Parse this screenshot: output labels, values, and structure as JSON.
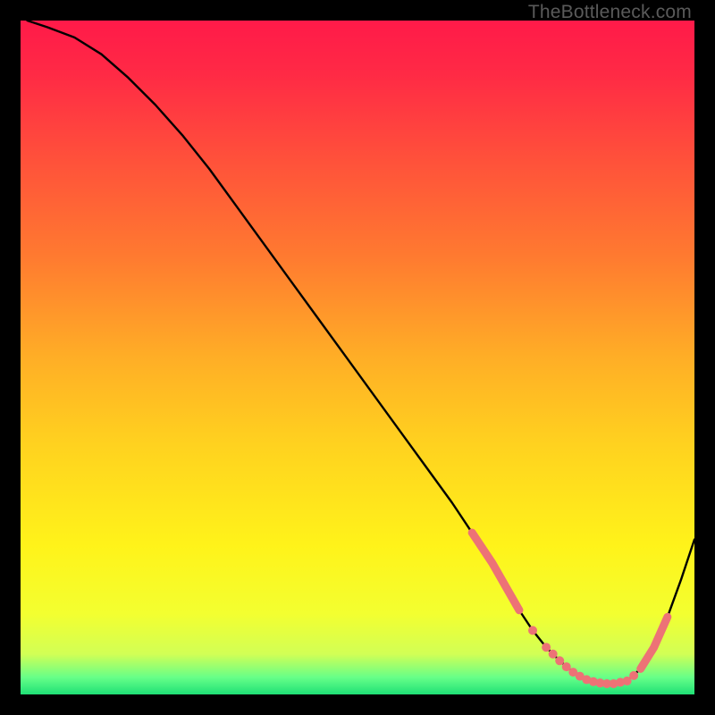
{
  "watermark": "TheBottleneck.com",
  "gradient_stops": [
    {
      "offset": 0.0,
      "color": "#ff1a49"
    },
    {
      "offset": 0.08,
      "color": "#ff2a45"
    },
    {
      "offset": 0.2,
      "color": "#ff4f3b"
    },
    {
      "offset": 0.35,
      "color": "#ff7a30"
    },
    {
      "offset": 0.5,
      "color": "#ffae26"
    },
    {
      "offset": 0.63,
      "color": "#ffd21f"
    },
    {
      "offset": 0.78,
      "color": "#fff31a"
    },
    {
      "offset": 0.88,
      "color": "#f3ff30"
    },
    {
      "offset": 0.94,
      "color": "#d2ff55"
    },
    {
      "offset": 0.975,
      "color": "#66ff88"
    },
    {
      "offset": 1.0,
      "color": "#1fe076"
    }
  ],
  "chart_data": {
    "type": "line",
    "title": "",
    "xlabel": "",
    "ylabel": "",
    "xlim": [
      0,
      100
    ],
    "ylim": [
      0,
      100
    ],
    "series": [
      {
        "name": "bottleneck-curve",
        "color": "#000000",
        "x": [
          1,
          4,
          8,
          12,
          16,
          20,
          24,
          28,
          32,
          36,
          40,
          44,
          48,
          52,
          56,
          60,
          64,
          67,
          70,
          72,
          74,
          76,
          78,
          80,
          82,
          84,
          86,
          88,
          90,
          92,
          94,
          96,
          98,
          100
        ],
        "y": [
          100,
          99,
          97.5,
          95,
          91.5,
          87.5,
          83,
          78,
          72.5,
          67,
          61.5,
          56,
          50.5,
          45,
          39.5,
          34,
          28.5,
          24,
          19.5,
          16,
          12.5,
          9.5,
          7,
          5,
          3.3,
          2.2,
          1.7,
          1.6,
          2.0,
          3.8,
          7.0,
          11.5,
          17,
          23
        ]
      }
    ],
    "highlight_segments": [
      {
        "name": "left-pink-segment",
        "color": "#ed7276",
        "stroke_width": 9,
        "x": [
          67,
          70,
          72,
          74
        ],
        "y": [
          24,
          19.5,
          16,
          12.5
        ]
      },
      {
        "name": "right-pink-segment",
        "color": "#ed7276",
        "stroke_width": 9,
        "x": [
          92,
          94,
          96
        ],
        "y": [
          3.8,
          7.0,
          11.5
        ]
      }
    ],
    "highlight_points": {
      "name": "trough-points",
      "color": "#ed7276",
      "radius": 5,
      "x": [
        76,
        78,
        79,
        80,
        81,
        82,
        83,
        84,
        85,
        86,
        87,
        88,
        89,
        90,
        91
      ],
      "y": [
        9.5,
        7,
        6,
        5,
        4.1,
        3.3,
        2.7,
        2.2,
        1.9,
        1.7,
        1.6,
        1.6,
        1.8,
        2.0,
        2.8
      ]
    }
  }
}
